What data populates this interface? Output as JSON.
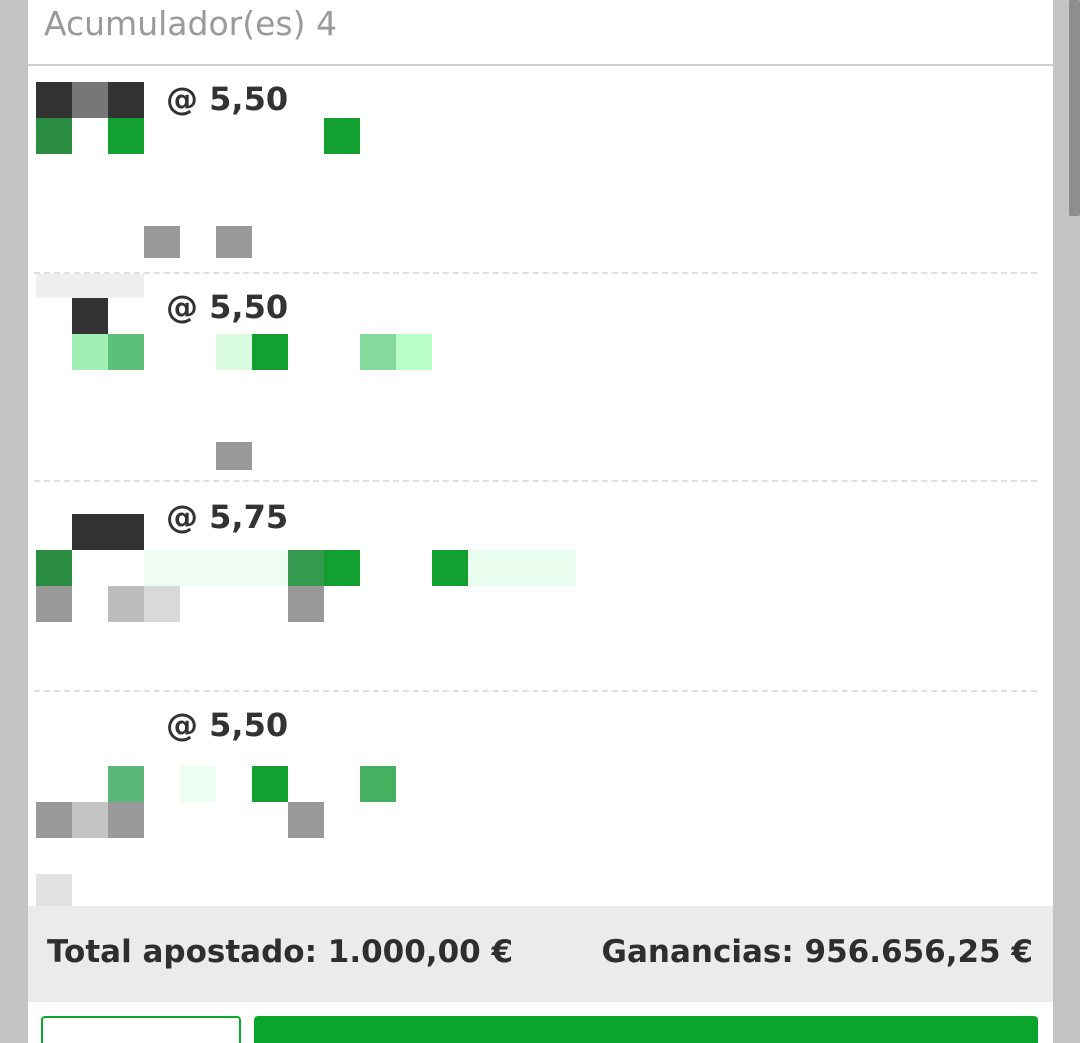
{
  "header": {
    "title": "Acumulador(es) 4"
  },
  "bets": [
    {
      "odds": "@ 5,50"
    },
    {
      "odds": "@ 5,50"
    },
    {
      "odds": "@ 5,75"
    },
    {
      "odds": "@ 5,50"
    }
  ],
  "footer": {
    "total": "Total apostado: 1.000,00 €",
    "gains": "Ganancias: 956.656,25 €"
  },
  "colors": {
    "accent_green": "#09a62b",
    "text_dark": "#2e2e2e",
    "header_gray": "#9a9a9a"
  }
}
